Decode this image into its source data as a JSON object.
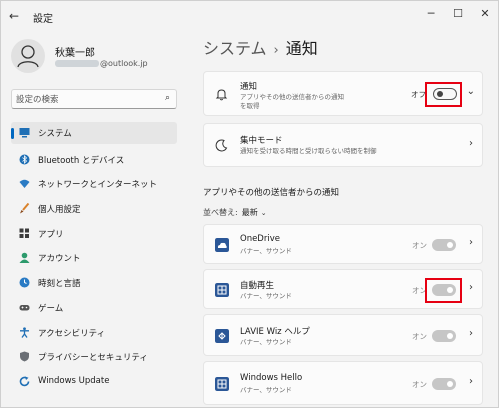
{
  "window": {
    "title": "設定",
    "back_glyph": "←",
    "minimize_glyph": "─",
    "maximize_glyph": "☐",
    "close_glyph": "✕"
  },
  "user": {
    "name": "秋葉一郎",
    "email_domain": "@outlook.jp"
  },
  "search": {
    "placeholder": "設定の検索"
  },
  "nav": [
    {
      "label": "システム",
      "icon": "system-icon",
      "active": true
    },
    {
      "label": "Bluetooth とデバイス",
      "icon": "bluetooth-icon"
    },
    {
      "label": "ネットワークとインターネット",
      "icon": "wifi-icon"
    },
    {
      "label": "個人用設定",
      "icon": "brush-icon"
    },
    {
      "label": "アプリ",
      "icon": "apps-icon"
    },
    {
      "label": "アカウント",
      "icon": "account-icon"
    },
    {
      "label": "時刻と言語",
      "icon": "globe-clock-icon"
    },
    {
      "label": "ゲーム",
      "icon": "gamepad-icon"
    },
    {
      "label": "アクセシビリティ",
      "icon": "accessibility-icon"
    },
    {
      "label": "プライバシーとセキュリティ",
      "icon": "shield-icon"
    },
    {
      "label": "Windows Update",
      "icon": "update-icon"
    }
  ],
  "breadcrumb": {
    "parent": "システム",
    "separator": "›",
    "current": "通知"
  },
  "notifications_card": {
    "title": "通知",
    "subtitle_line1": "アプリやその他の送信者からの通知",
    "subtitle_line2": "を取得",
    "toggle_text": "オフ",
    "toggle_on": false,
    "expand_glyph": "⌄"
  },
  "focus_card": {
    "title": "集中モード",
    "subtitle": "通知を受け取る時間と受け取らない時間を制御",
    "chevron": "›"
  },
  "apps_section": {
    "header": "アプリやその他の送信者からの通知",
    "sort_label": "並べ替え:",
    "sort_value": "最新",
    "apps": [
      {
        "name": "OneDrive",
        "sub": "バナー、サウンド",
        "toggle_text": "オン",
        "icon": "onedrive-icon"
      },
      {
        "name": "自動再生",
        "sub": "バナー、サウンド",
        "toggle_text": "オン",
        "icon": "autoplay-icon"
      },
      {
        "name": "LAVIE Wiz ヘルプ",
        "sub": "バナー、サウンド",
        "toggle_text": "オン",
        "icon": "lavie-help-icon"
      },
      {
        "name": "Windows Hello",
        "sub": "バナー、サウンド",
        "toggle_text": "オン",
        "icon": "windows-hello-icon"
      }
    ]
  },
  "colors": {
    "accent": "#0067c0",
    "highlight": "#e60012",
    "app_tile": "#2b5797"
  }
}
